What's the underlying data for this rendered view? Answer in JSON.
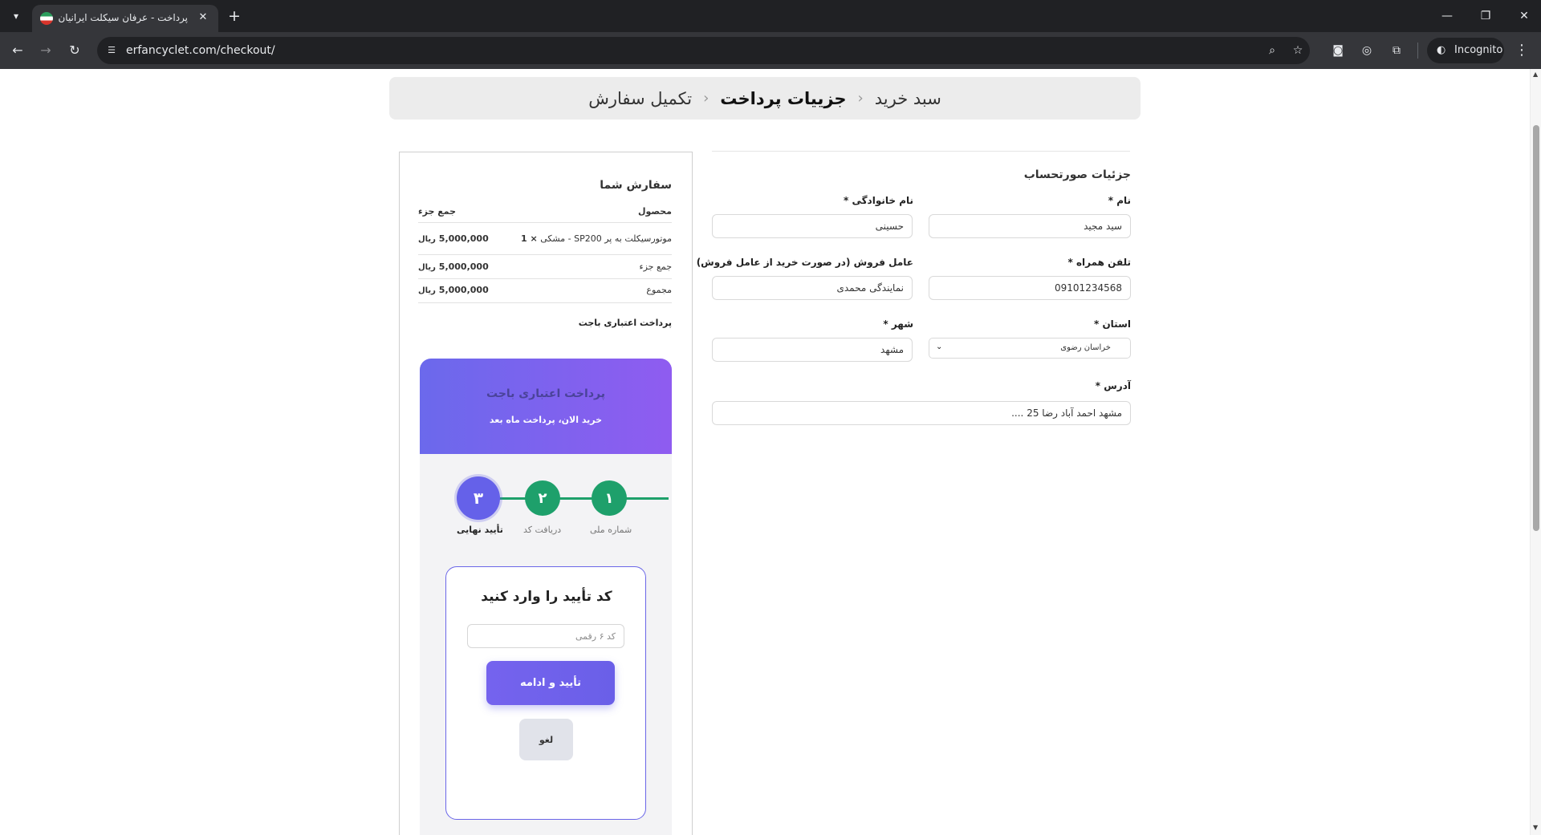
{
  "browser": {
    "tab_title": "پرداخت - عرفان سیکلت ایرانیان",
    "url": "erfancyclet.com/checkout/",
    "profile_label": "Incognito"
  },
  "breadcrumb": {
    "step1": "سبد خرید",
    "step2": "جزییات پرداخت",
    "step3": "تکمیل سفارش"
  },
  "billing": {
    "title": "جزئیات صورتحساب",
    "first_name_label": "نام *",
    "first_name_value": "سید مجید",
    "last_name_label": "نام خانوادگی *",
    "last_name_value": "حسینی",
    "phone_label": "تلفن همراه *",
    "phone_value": "09101234568",
    "agent_label": "عامل فروش (در صورت خرید از عامل فروش)",
    "agent_value": "نمایندگی محمدی",
    "province_label": "استان *",
    "province_value": "خراسان رضوی",
    "city_label": "شهر *",
    "city_value": "مشهد",
    "address_label": "آدرس *",
    "address_value": "مشهد احمد آباد رضا 25 ...."
  },
  "order": {
    "title": "سفارش شما",
    "col_product": "محصول",
    "col_subtotal": "جمع جزء",
    "item_name": "موتورسیکلت به پر SP200 - مشکی",
    "item_qty": "× 1",
    "item_price": "5,000,000",
    "subtotal_label": "جمع جزء",
    "subtotal_value": "5,000,000",
    "total_label": "مجموع",
    "total_value": "5,000,000",
    "currency": "ریال",
    "gateway_label": "پرداخت اعتباری باجت"
  },
  "bnpl": {
    "header_title": "پرداخت اعتباری باجت",
    "header_subtitle": "خرید الان، پرداخت ماه بعد",
    "steps": [
      {
        "number": "۱",
        "label": "شماره ملی"
      },
      {
        "number": "۲",
        "label": "دریافت کد"
      },
      {
        "number": "۳",
        "label": "تأیید نهایی"
      }
    ],
    "otp_title": "کد تأیید را وارد کنید",
    "otp_placeholder": "کد ۶ رقمی",
    "confirm_label": "تأیید و ادامه",
    "cancel_label": "لغو"
  },
  "colors": {
    "accent": "#6561e9",
    "step_done": "#1ea06b"
  }
}
